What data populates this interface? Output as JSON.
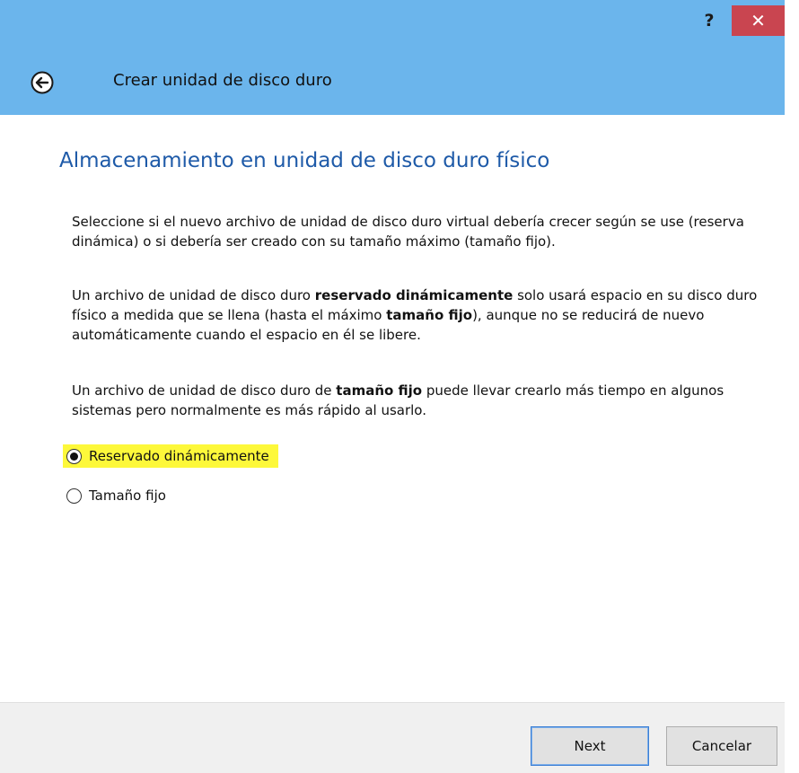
{
  "titlebar": {
    "help_label": "?",
    "close_label": "✕",
    "back_icon": "back-arrow-icon",
    "title": "Crear unidad de disco duro"
  },
  "content": {
    "heading": "Almacenamiento en unidad de disco duro físico",
    "p1": "Seleccione si el nuevo archivo de unidad de disco duro virtual debería crecer según se use (reserva dinámica) o si debería ser creado con su tamaño máximo (tamaño fijo).",
    "p2": {
      "a": "Un archivo de unidad de disco duro ",
      "b": "reservado dinámicamente",
      "c": " solo usará espacio en su disco duro físico a medida que se llena (hasta el máximo ",
      "d": "tamaño fijo",
      "e": "), aunque no se reducirá de nuevo automáticamente cuando el espacio en él se libere."
    },
    "p3": {
      "a": "Un archivo de unidad de disco duro de ",
      "b": "tamaño fijo",
      "c": " puede llevar crearlo más tiempo en algunos sistemas pero normalmente es más rápido al usarlo."
    },
    "options": [
      {
        "label": "Reservado dinámicamente",
        "selected": true,
        "highlight_color": "#fdf83a"
      },
      {
        "label": "Tamaño fijo",
        "selected": false
      }
    ]
  },
  "footer": {
    "next_label": "Next",
    "cancel_label": "Cancelar"
  },
  "colors": {
    "titlebar": "#6bb5ec",
    "close_button": "#c94550",
    "heading": "#1e5aa8",
    "footer": "#f0f0f0"
  }
}
